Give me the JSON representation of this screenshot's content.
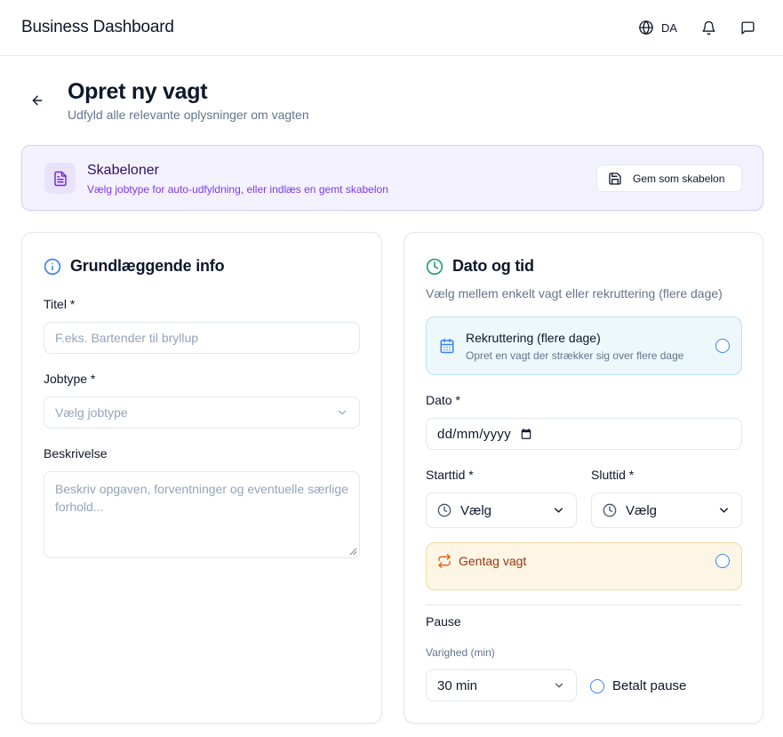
{
  "header": {
    "app_title": "Business Dashboard",
    "language_code": "DA",
    "icons": [
      "globe-icon",
      "bell-icon",
      "message-icon"
    ]
  },
  "page": {
    "title": "Opret ny vagt",
    "subtitle": "Udfyld alle relevante oplysninger om vagten"
  },
  "templates": {
    "title": "Skabeloner",
    "subtitle": "Vælg jobtype for auto-udfyldning, eller indlæs en gemt skabelon",
    "save_button": "Gem som skabelon",
    "accent_color": "#7c3aed"
  },
  "basic_info": {
    "heading": "Grundlæggende info",
    "title_label": "Titel *",
    "title_placeholder": "F.eks. Bartender til bryllup",
    "title_value": "",
    "jobtype_label": "Jobtype *",
    "jobtype_placeholder": "Vælg jobtype",
    "description_label": "Beskrivelse",
    "description_placeholder": "Beskriv opgaven, forventninger og eventuelle særlige forhold..."
  },
  "date_time": {
    "heading": "Dato og tid",
    "subtitle": "Vælg mellem enkelt vagt eller rekruttering (flere dage)",
    "recruit_title": "Rekruttering (flere dage)",
    "recruit_subtitle": "Opret en vagt der strækker sig over flere dage",
    "recruit_checked": false,
    "date_label": "Dato *",
    "date_value": "dd/mm/yyyy",
    "start_label": "Starttid *",
    "start_value": "Vælg",
    "end_label": "Sluttid *",
    "end_value": "Vælg",
    "repeat_label": "Gentag vagt",
    "repeat_checked": false,
    "pause_heading": "Pause",
    "duration_label": "Varighed (min)",
    "duration_value": "30 min",
    "paid_pause_label": "Betalt pause",
    "paid_pause_checked": false
  }
}
